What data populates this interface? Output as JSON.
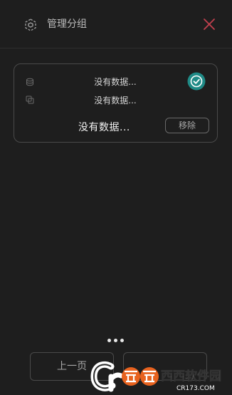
{
  "header": {
    "title": "管理分组",
    "app_icon": "group-cube-icon",
    "close_icon": "close-icon"
  },
  "card": {
    "rows": [
      {
        "icon": "database-icon",
        "text": "没有数据..."
      },
      {
        "icon": "copy-icon",
        "text": "没有数据..."
      }
    ],
    "check_icon": "check-circle-icon",
    "main_text": "没有数据...",
    "remove_label": "移除"
  },
  "pagination": {
    "dots_count": 3,
    "prev_label": "上一页"
  },
  "watermark": {
    "brand": "西西软件园",
    "site": "CR173.COM"
  },
  "colors": {
    "background": "#1e1e1e",
    "close": "#c2404e",
    "check": "#1f8a86",
    "watermark_orange": "#e8621e"
  }
}
